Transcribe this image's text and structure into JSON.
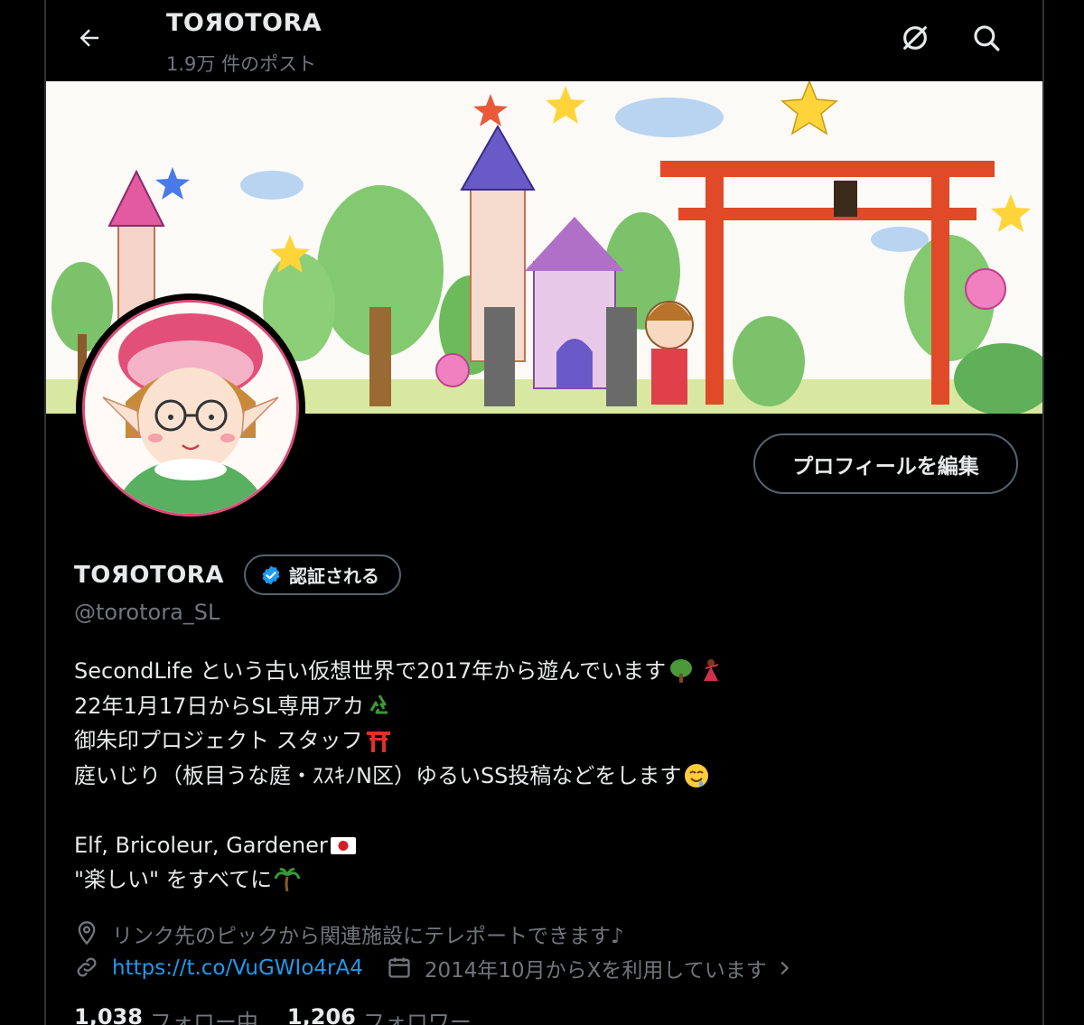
{
  "header": {
    "title": "TOЯOTORA",
    "post_count": "1.9万 件のポスト"
  },
  "profile": {
    "display_name": "TOЯOTORA",
    "verified_label": "認証される",
    "handle": "@torotora_SL",
    "edit_button": "プロフィールを編集"
  },
  "bio": {
    "line1": "SecondLife という古い仮想世界で2017年から遊んでいます",
    "line2": "22年1月17日からSL専用アカ",
    "line3": "御朱印プロジェクト スタッフ",
    "line4": "庭いじり（板目うな庭・ｽｽｷﾉN区）ゆるいSS投稿などをします",
    "line5": "Elf, Bricoleur, Gardener",
    "line6": "\"楽しい\" をすべてに"
  },
  "meta": {
    "location": "リンク先のピックから関連施設にテレポートできます♪",
    "url": "https://t.co/VuGWIo4rA4",
    "joined": "2014年10月からXを利用しています"
  },
  "stats": {
    "following_count": "1,038",
    "following_label": "フォロー中",
    "followers_count": "1,206",
    "followers_label": "フォロワー"
  },
  "colors": {
    "background": "#000000",
    "text": "#e7e9ea",
    "muted": "#71767b",
    "link": "#1d9bf0",
    "border": "#536471",
    "verified": "#1d9bf0"
  },
  "icons": [
    "back-arrow-icon",
    "grok-icon",
    "search-icon",
    "verified-badge-icon",
    "location-icon",
    "link-icon",
    "calendar-icon",
    "chevron-right-icon"
  ]
}
